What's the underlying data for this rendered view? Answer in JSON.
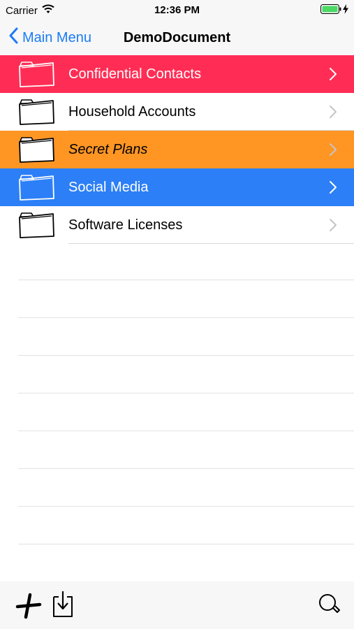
{
  "status_bar": {
    "carrier": "Carrier",
    "time": "12:36 PM",
    "icons": [
      "wifi-icon",
      "battery-icon",
      "charging-bolt-icon"
    ]
  },
  "nav": {
    "back_label": "Main Menu",
    "title": "DemoDocument"
  },
  "folders": [
    {
      "label": "Confidential Contacts",
      "background": "#ff2d55",
      "text_color": "#ffffff",
      "italic": false,
      "icon": "folder-icon"
    },
    {
      "label": "Household Accounts",
      "background": "#ffffff",
      "text_color": "#000000",
      "italic": false,
      "icon": "folder-icon"
    },
    {
      "label": "Secret Plans",
      "background": "#ff9624",
      "text_color": "#000000",
      "italic": true,
      "icon": "folder-icon"
    },
    {
      "label": "Social Media",
      "background": "#2c7ff6",
      "text_color": "#ffffff",
      "italic": false,
      "icon": "folder-icon"
    },
    {
      "label": "Software Licenses",
      "background": "#ffffff",
      "text_color": "#000000",
      "italic": false,
      "icon": "folder-icon"
    }
  ],
  "toolbar": {
    "icons": [
      "add-icon",
      "import-icon",
      "search-icon"
    ]
  },
  "colors": {
    "accent": "#1a7cf5",
    "battery_green": "#4cd964"
  }
}
